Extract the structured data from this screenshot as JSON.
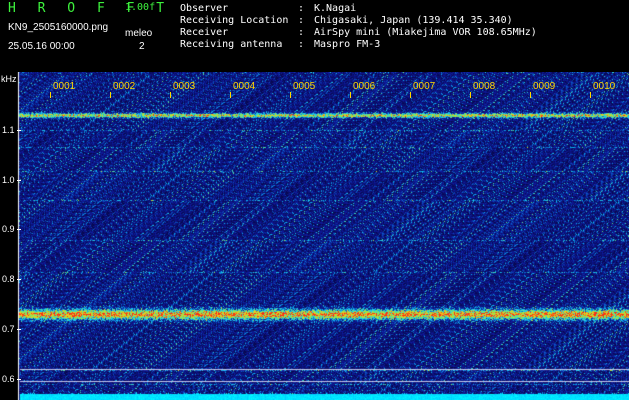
{
  "header": {
    "brand": "HROFFT",
    "version": "1.00f",
    "filename": "KN9_2505160000.png",
    "meleo_label": "meleo",
    "count": "2",
    "datetime": "25.05.16 00:00",
    "info": [
      {
        "key": "Observer",
        "value": "K.Nagai"
      },
      {
        "key": "Receiving Location",
        "value": "Chigasaki, Japan (139.414 35.340)"
      },
      {
        "key": "Receiver",
        "value": "AirSpy mini (Miakejima VOR 108.65MHz)"
      },
      {
        "key": "Receiving antenna",
        "value": "Maspro FM-3"
      }
    ]
  },
  "spectrogram": {
    "unit_label": "kHz",
    "y_ticks": [
      "1.1",
      "1.0",
      "0.9",
      "0.8",
      "0.7",
      "0.6"
    ],
    "time_markers": [
      "0001",
      "0002",
      "0003",
      "0004",
      "0005",
      "0006",
      "0007",
      "0008",
      "0009",
      "0010"
    ],
    "colors": {
      "background": "#0a0a5e",
      "signal_strong": "#ff3020",
      "signal_mid": "#30e030",
      "baseline": "#00e5ff"
    }
  }
}
